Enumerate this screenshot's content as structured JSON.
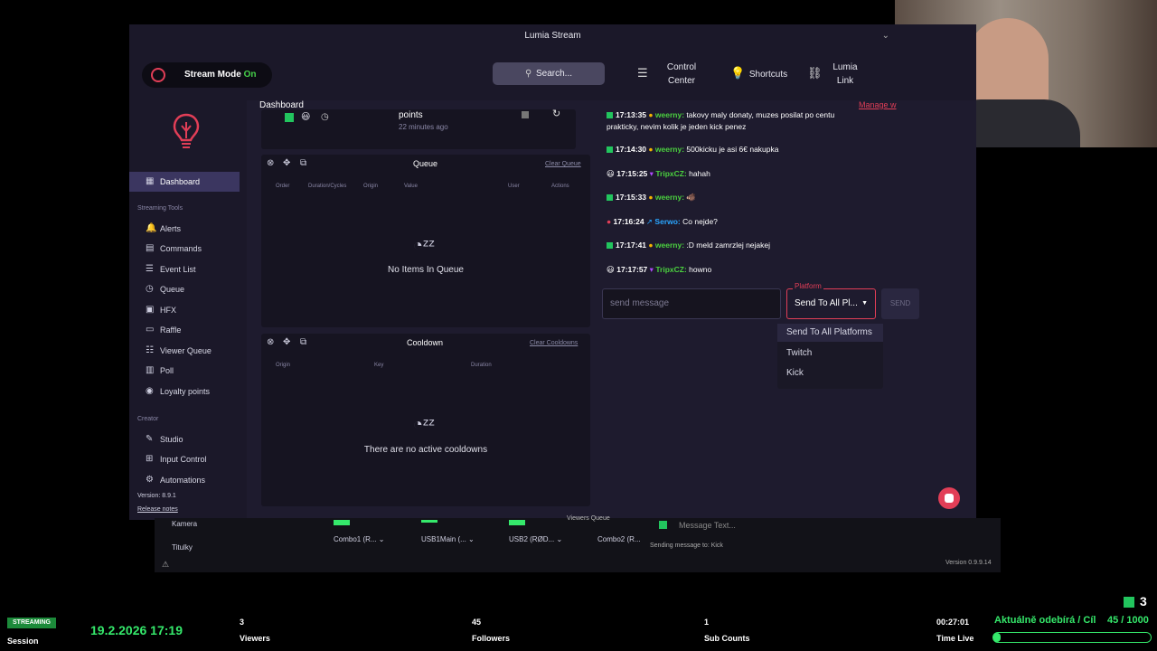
{
  "window": {
    "title": "Lumia Stream"
  },
  "topbar": {
    "stream_mode_label": "Stream Mode",
    "stream_mode_state": "On",
    "search_placeholder": "Search...",
    "control_center_l1": "Control",
    "control_center_l2": "Center",
    "shortcuts": "Shortcuts",
    "lumia_link_l1": "Lumia",
    "lumia_link_l2": "Link"
  },
  "sidebar": {
    "dashboard": "Dashboard",
    "streaming_tools": "Streaming Tools",
    "items": [
      "Alerts",
      "Commands",
      "Event List",
      "Queue",
      "HFX",
      "Raffle",
      "Viewer Queue",
      "Poll",
      "Loyalty points"
    ],
    "creator": "Creator",
    "creator_items": [
      "Studio",
      "Input Control",
      "Automations"
    ],
    "version": "Version: 8.9.1",
    "release_notes": "Release notes"
  },
  "main": {
    "title": "Dashboard",
    "top_item_label": "points",
    "top_item_time": "22 minutes ago",
    "queue": {
      "title": "Queue",
      "clear": "Clear Queue",
      "columns": [
        "Order",
        "Duration/Cycles",
        "Origin",
        "Value",
        "User",
        "Actions"
      ],
      "empty": "No Items In Queue"
    },
    "cooldown": {
      "title": "Cooldown",
      "clear": "Clear Cooldowns",
      "columns": [
        "Origin",
        "Key",
        "Duration"
      ],
      "empty": "There are no active cooldowns"
    },
    "manage": "Manage w"
  },
  "chat": {
    "messages": [
      {
        "time": "17:13:35",
        "user": "weerny:",
        "text": "takovy maly donaty, muzes posilat po centu",
        "text2": "prakticky, nevim kolik je jeden kick penez"
      },
      {
        "time": "17:14:30",
        "user": "weerny:",
        "text": "500kicku je asi 6€ nakupka"
      },
      {
        "time": "17:15:25",
        "user": "TripxCZ:",
        "text": "hahah"
      },
      {
        "time": "17:15:33",
        "user": "weerny:",
        "text": "🐗"
      },
      {
        "time": "17:16:24",
        "user": "Serwo:",
        "text": "Co nejde?"
      },
      {
        "time": "17:17:41",
        "user": "weerny:",
        "text": ":D meld zamrzlej nejakej"
      },
      {
        "time": "17:17:57",
        "user": "TripxCZ:",
        "text": "howno"
      }
    ],
    "input_placeholder": "send message",
    "platform_label": "Platform",
    "platform_value": "Send To All Pl...",
    "send": "SEND",
    "options": [
      "Send To All Platforms",
      "Twitch",
      "Kick"
    ]
  },
  "obs": {
    "sources": [
      "Kamera",
      "Titulky"
    ],
    "mixers": [
      "Combo1 (R...",
      "USB1Main (...",
      "USB2 (RØD...",
      "Combo2 (R..."
    ],
    "viewers_queue": "Viewers Queue",
    "message_placeholder": "Message Text...",
    "sending_to": "Sending message to: Kick",
    "version": "Version 0.9.9.14"
  },
  "stats": {
    "status": "STREAMING",
    "session_label": "Session",
    "datetime": "19.2.2026 17:19",
    "viewers_n": "3",
    "viewers_l": "Viewers",
    "followers_n": "45",
    "followers_l": "Followers",
    "subs_n": "1",
    "subs_l": "Sub Counts",
    "live_time": "00:27:01",
    "live_l": "Time Live",
    "goal_text": "Aktuálně odebírá / Cíl",
    "goal_value": "45 / 1000",
    "goal_fraction": 0.045,
    "kick_count": "3"
  }
}
